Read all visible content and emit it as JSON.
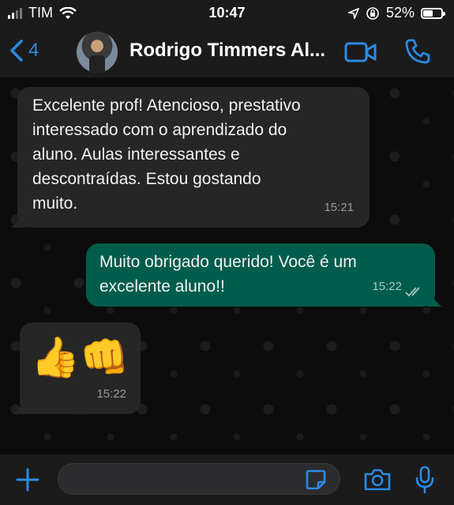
{
  "status_bar": {
    "carrier": "TIM",
    "time": "10:47",
    "battery_percent": "52%",
    "battery_level": 0.52
  },
  "header": {
    "back_count": "4",
    "contact_name": "Rodrigo Timmers Al..."
  },
  "messages": [
    {
      "direction": "incoming",
      "lines": [
        "Excelente prof! Atencioso, prestativo",
        "interessado com o aprendizado do",
        "aluno. Aulas interessantes e",
        "descontraídas. Estou gostando",
        "muito."
      ],
      "time": "15:21"
    },
    {
      "direction": "outgoing",
      "lines": [
        "Muito obrigado querido! Você é um",
        "excelente aluno!!"
      ],
      "time": "15:22",
      "status": "read"
    },
    {
      "direction": "incoming",
      "emoji": "👍👊",
      "time": "15:22"
    }
  ],
  "colors": {
    "accent": "#2b8be6",
    "incoming_bubble": "#262626",
    "outgoing_bubble": "#005c4b"
  },
  "icons": [
    "back-chevron-icon",
    "video-call-icon",
    "phone-icon",
    "plus-icon",
    "sticker-icon",
    "camera-icon",
    "microphone-icon"
  ]
}
